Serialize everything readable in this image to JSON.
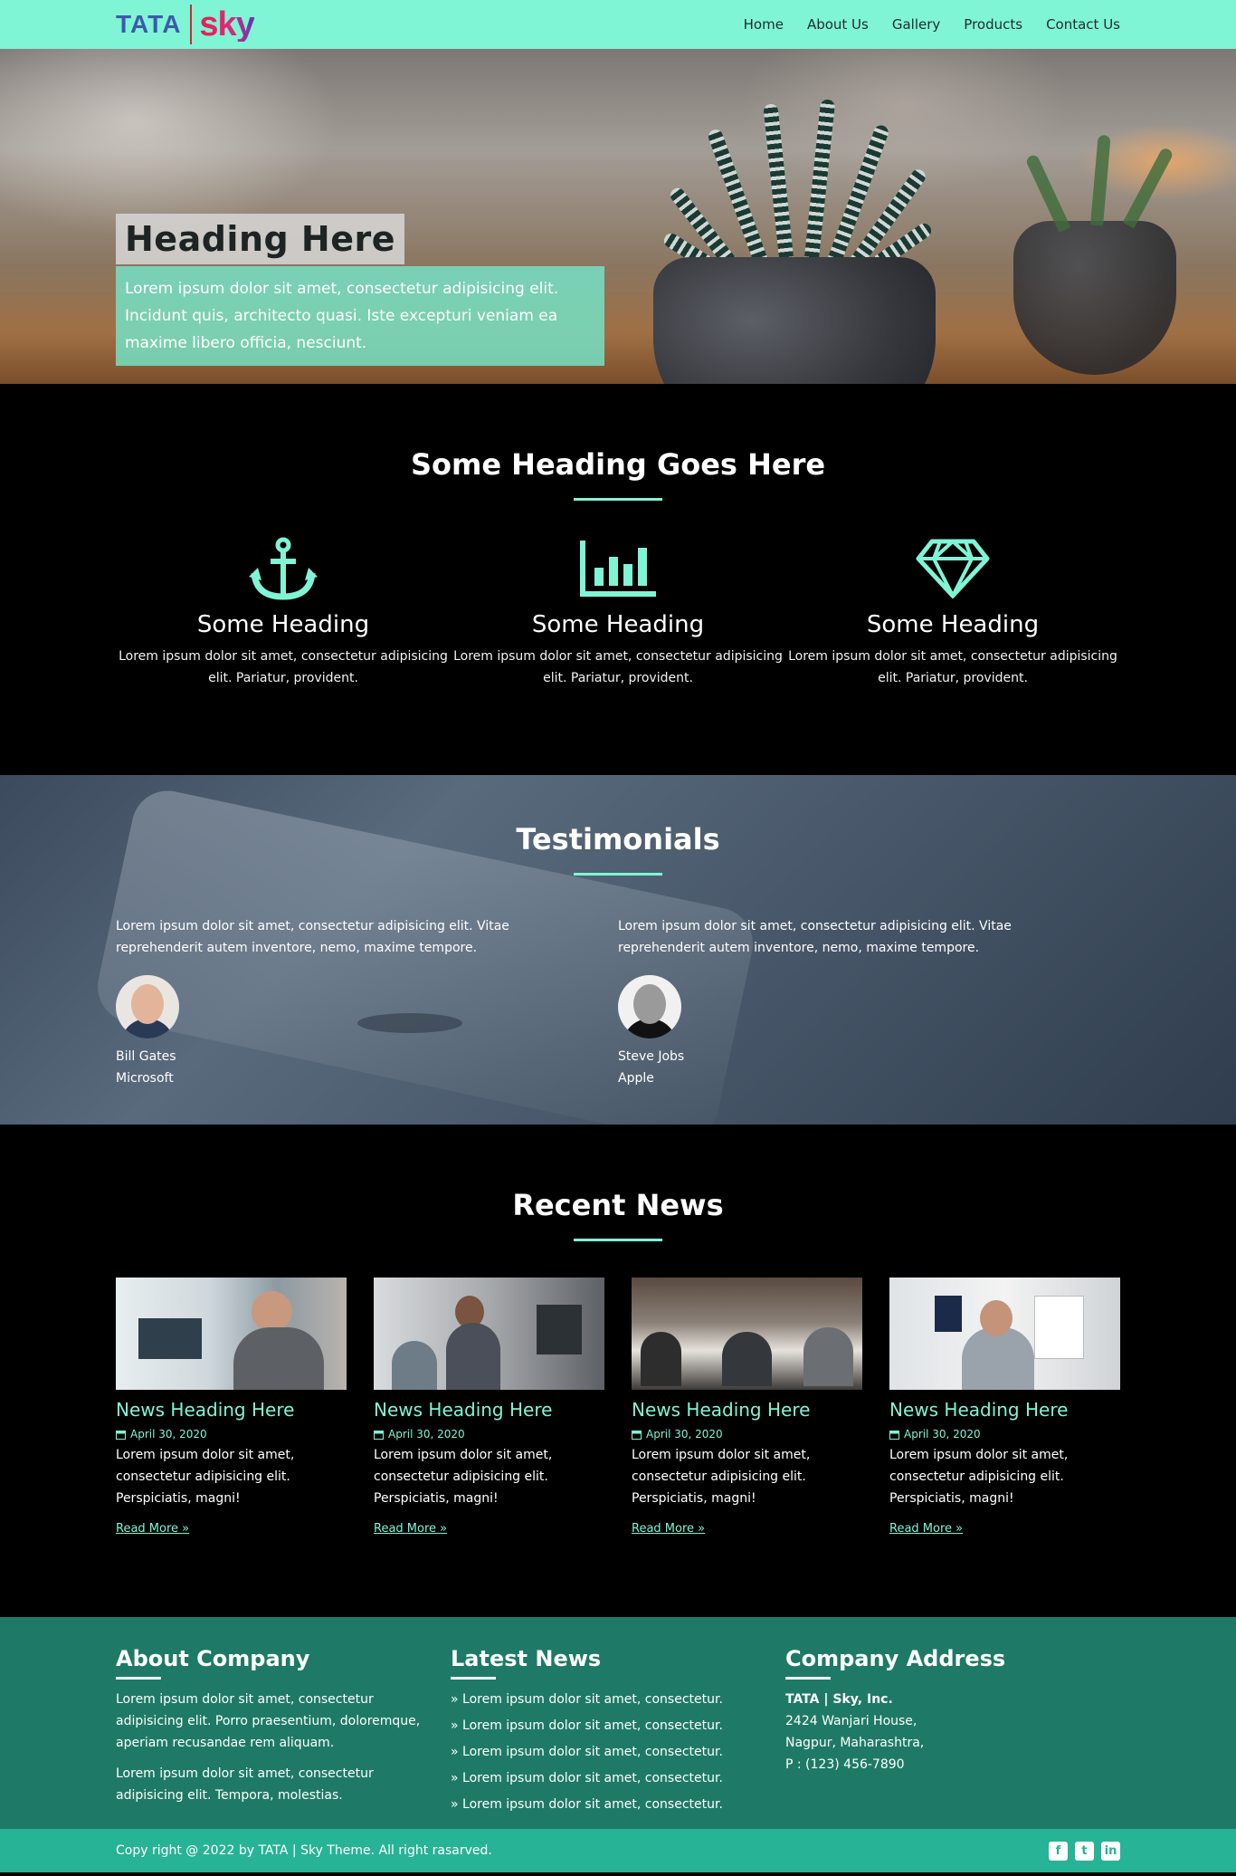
{
  "nav": {
    "logo_left": "TATA",
    "logo_right": "sky",
    "items": [
      "Home",
      "About Us",
      "Gallery",
      "Products",
      "Contact Us"
    ]
  },
  "hero": {
    "title": "Heading Here",
    "text": "Lorem ipsum dolor sit amet, consectetur adipisicing elit. Incidunt quis, architecto quasi. Iste excepturi veniam ea maxime libero officia, nesciunt."
  },
  "features": {
    "title": "Some Heading Goes Here",
    "items": [
      {
        "icon": "anchor-icon",
        "heading": "Some Heading",
        "text": "Lorem ipsum dolor sit amet, consectetur adipisicing elit. Pariatur, provident."
      },
      {
        "icon": "bar-chart-icon",
        "heading": "Some Heading",
        "text": "Lorem ipsum dolor sit amet, consectetur adipisicing elit. Pariatur, provident."
      },
      {
        "icon": "diamond-icon",
        "heading": "Some Heading",
        "text": "Lorem ipsum dolor sit amet, consectetur adipisicing elit. Pariatur, provident."
      }
    ]
  },
  "testimonials": {
    "title": "Testimonials",
    "items": [
      {
        "quote": "Lorem ipsum dolor sit amet, consectetur adipisicing elit. Vitae reprehenderit autem inventore, nemo, maxime tempore.",
        "name": "Bill Gates",
        "company": "Microsoft"
      },
      {
        "quote": "Lorem ipsum dolor sit amet, consectetur adipisicing elit. Vitae reprehenderit autem inventore, nemo, maxime tempore.",
        "name": "Steve Jobs",
        "company": "Apple"
      }
    ]
  },
  "news": {
    "title": "Recent News",
    "items": [
      {
        "heading": "News Heading Here",
        "date": "April 30, 2020",
        "text": "Lorem ipsum dolor sit amet, consectetur adipisicing elit. Perspiciatis, magni!",
        "more": "Read More"
      },
      {
        "heading": "News Heading Here",
        "date": "April 30, 2020",
        "text": "Lorem ipsum dolor sit amet, consectetur adipisicing elit. Perspiciatis, magni!",
        "more": "Read More"
      },
      {
        "heading": "News Heading Here",
        "date": "April 30, 2020",
        "text": "Lorem ipsum dolor sit amet, consectetur adipisicing elit. Perspiciatis, magni!",
        "more": "Read More"
      },
      {
        "heading": "News Heading Here",
        "date": "April 30, 2020",
        "text": "Lorem ipsum dolor sit amet, consectetur adipisicing elit. Perspiciatis, magni!",
        "more": "Read More"
      }
    ]
  },
  "footer": {
    "about": {
      "title": "About Company",
      "p1": "Lorem ipsum dolor sit amet, consectetur adipisicing elit. Porro praesentium, doloremque, aperiam recusandae rem aliquam.",
      "p2": "Lorem ipsum dolor sit amet, consectetur adipisicing elit. Tempora, molestias."
    },
    "latest": {
      "title": "Latest News",
      "items": [
        "Lorem ipsum dolor sit amet, consectetur.",
        "Lorem ipsum dolor sit amet, consectetur.",
        "Lorem ipsum dolor sit amet, consectetur.",
        "Lorem ipsum dolor sit amet, consectetur.",
        "Lorem ipsum dolor sit amet, consectetur."
      ]
    },
    "address": {
      "title": "Company Address",
      "company": "TATA | Sky, Inc.",
      "line1": "2424 Wanjari House,",
      "line2": "Nagpur, Maharashtra,",
      "phone": "P : (123) 456-7890"
    },
    "copyright": "Copy right @ 2022 by TATA | Sky Theme. All right rasarved.",
    "social": [
      "facebook-icon",
      "twitter-icon",
      "linkedin-icon"
    ]
  },
  "colors": {
    "accent": "#7ff5d6",
    "footer": "#1e7a66",
    "footer_bottom": "#27b395"
  }
}
